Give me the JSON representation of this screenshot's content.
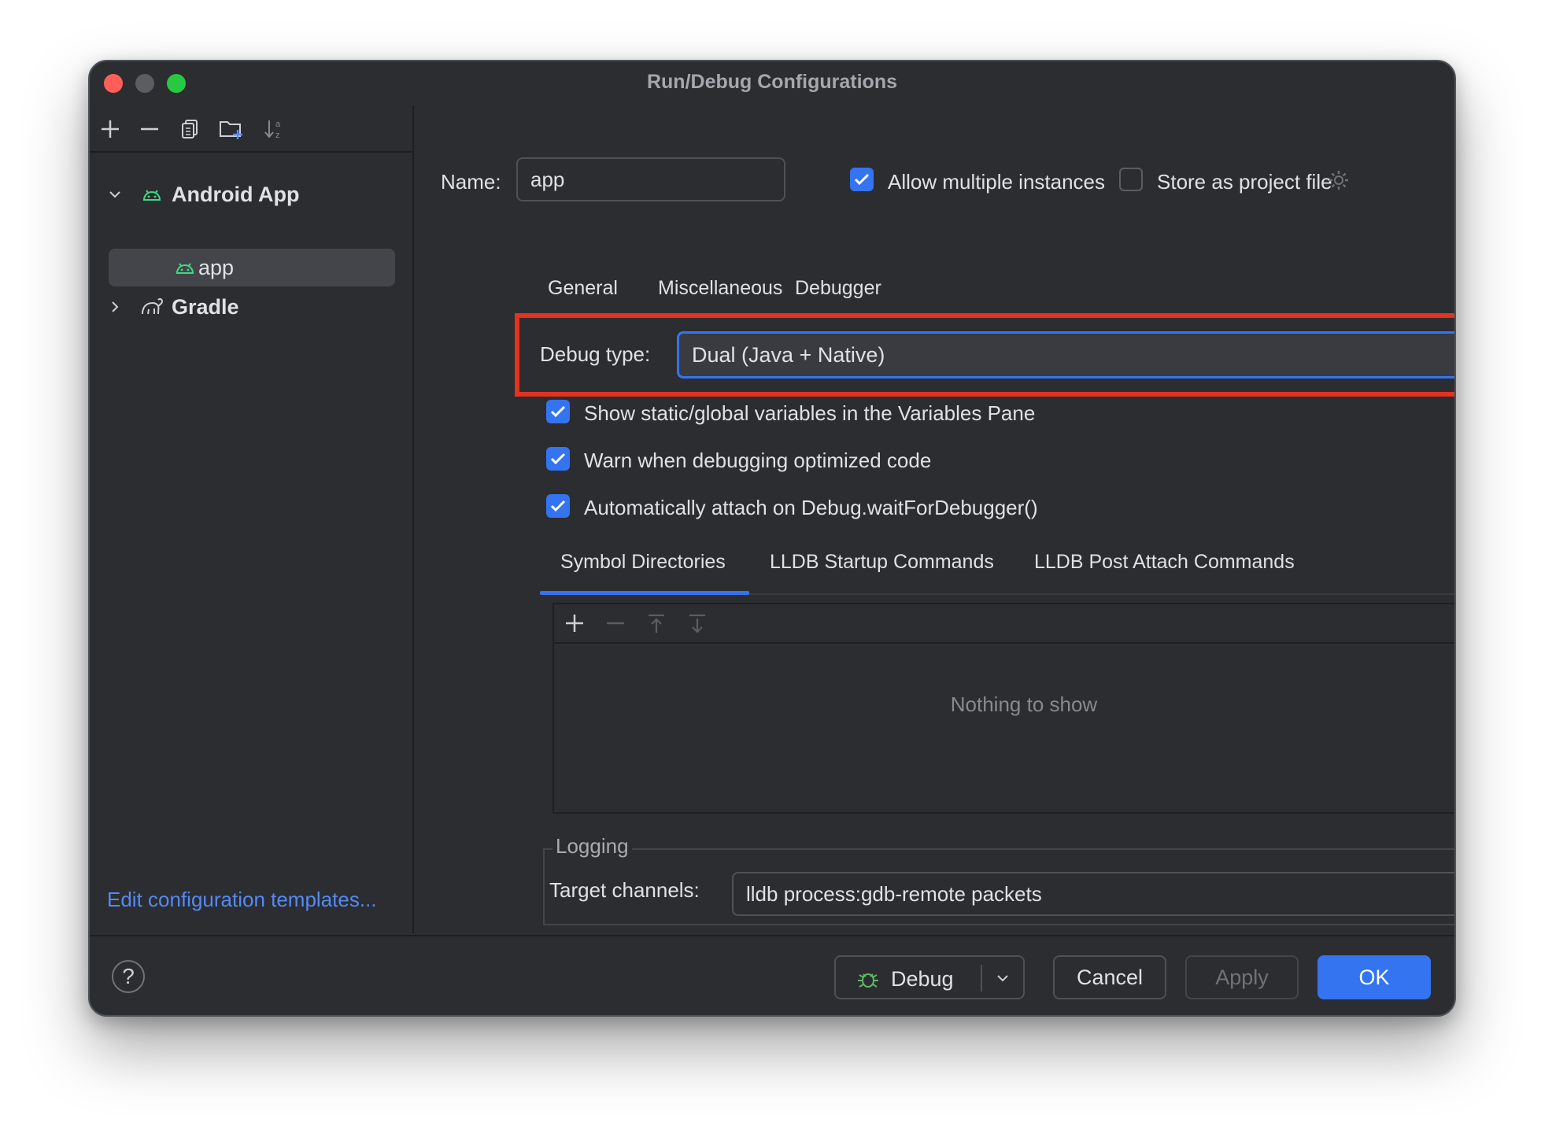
{
  "window": {
    "title": "Run/Debug Configurations"
  },
  "sidebar": {
    "toolbar_icons": [
      "add-icon",
      "remove-icon",
      "copy-icon",
      "new-folder-icon",
      "sort-icon"
    ],
    "tree": [
      {
        "label": "Android App",
        "expanded": true,
        "icon": "android-icon"
      },
      {
        "label": "app",
        "selected": true,
        "icon": "android-icon"
      },
      {
        "label": "Gradle",
        "expanded": false,
        "icon": "gradle-icon"
      }
    ],
    "edit_templates": "Edit configuration templates..."
  },
  "main": {
    "name_label": "Name:",
    "name_value": "app",
    "allow_multiple": {
      "label": "Allow multiple instances",
      "checked": true
    },
    "store_project": {
      "label": "Store as project file",
      "checked": false
    },
    "tabs": [
      "General",
      "Miscellaneous",
      "Debugger"
    ],
    "debug_type_label": "Debug type:",
    "debug_type_value": "Dual (Java + Native)",
    "options": [
      {
        "label": "Show static/global variables in the Variables Pane",
        "checked": true
      },
      {
        "label": "Warn when debugging optimized code",
        "checked": true
      },
      {
        "label": "Automatically attach on Debug.waitForDebugger()",
        "checked": true
      }
    ],
    "subtabs": [
      "Symbol Directories",
      "LLDB Startup Commands",
      "LLDB Post Attach Commands"
    ],
    "active_subtab": "Symbol Directories",
    "empty_text": "Nothing to show",
    "logging": {
      "title": "Logging",
      "target_label": "Target channels:",
      "target_value": "lldb process:gdb-remote packets"
    }
  },
  "footer": {
    "help": "?",
    "debug": "Debug",
    "cancel": "Cancel",
    "apply": "Apply",
    "ok": "OK"
  },
  "colors": {
    "accent": "#3574f0",
    "highlight": "#e3321f",
    "android": "#3ddc84",
    "link": "#548af7"
  }
}
